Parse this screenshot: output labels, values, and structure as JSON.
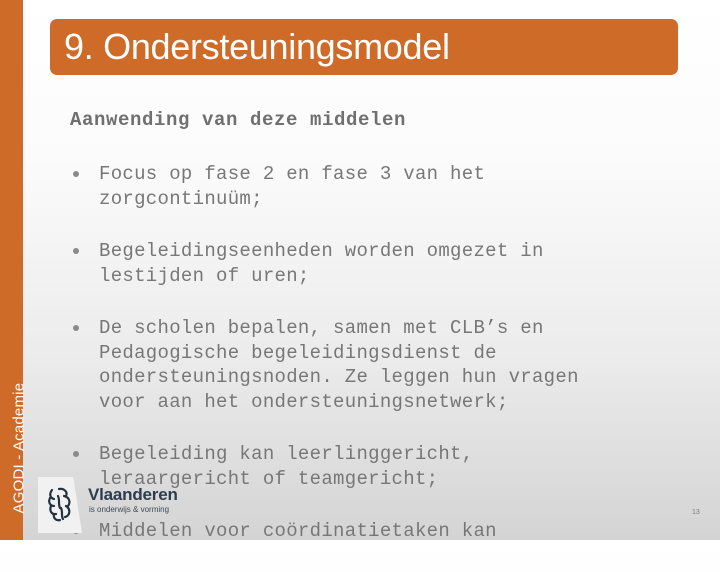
{
  "slide": {
    "title": "9. Ondersteuningsmodel",
    "side_label": "AGODI - Academie",
    "subheading": "Aanwending van deze middelen",
    "bullets": [
      {
        "text": "Focus op fase 2 en fase 3 van het\nzorgcontinuüm;"
      },
      {
        "text": "Begeleidingseenheden worden omgezet in\nlestijden of uren;"
      },
      {
        "text": "De scholen bepalen, samen met CLB’s en\nPedagogische begeleidingsdienst de\nondersteuningsnoden. Ze leggen hun vragen\nvoor aan het ondersteuningsnetwerk;"
      },
      {
        "text": "Begeleiding kan leerlinggericht,\nleraargericht of teamgericht;"
      },
      {
        "text": "Middelen voor coördinatietaken kan"
      }
    ],
    "page_number": "13"
  },
  "logo": {
    "brand": "Vlaanderen",
    "tagline": "is onderwijs & vorming",
    "icon": "flemish-lion-icon"
  },
  "colors": {
    "accent": "#cf6b29",
    "text": "#777777",
    "brand_text": "#2b3d4f"
  }
}
